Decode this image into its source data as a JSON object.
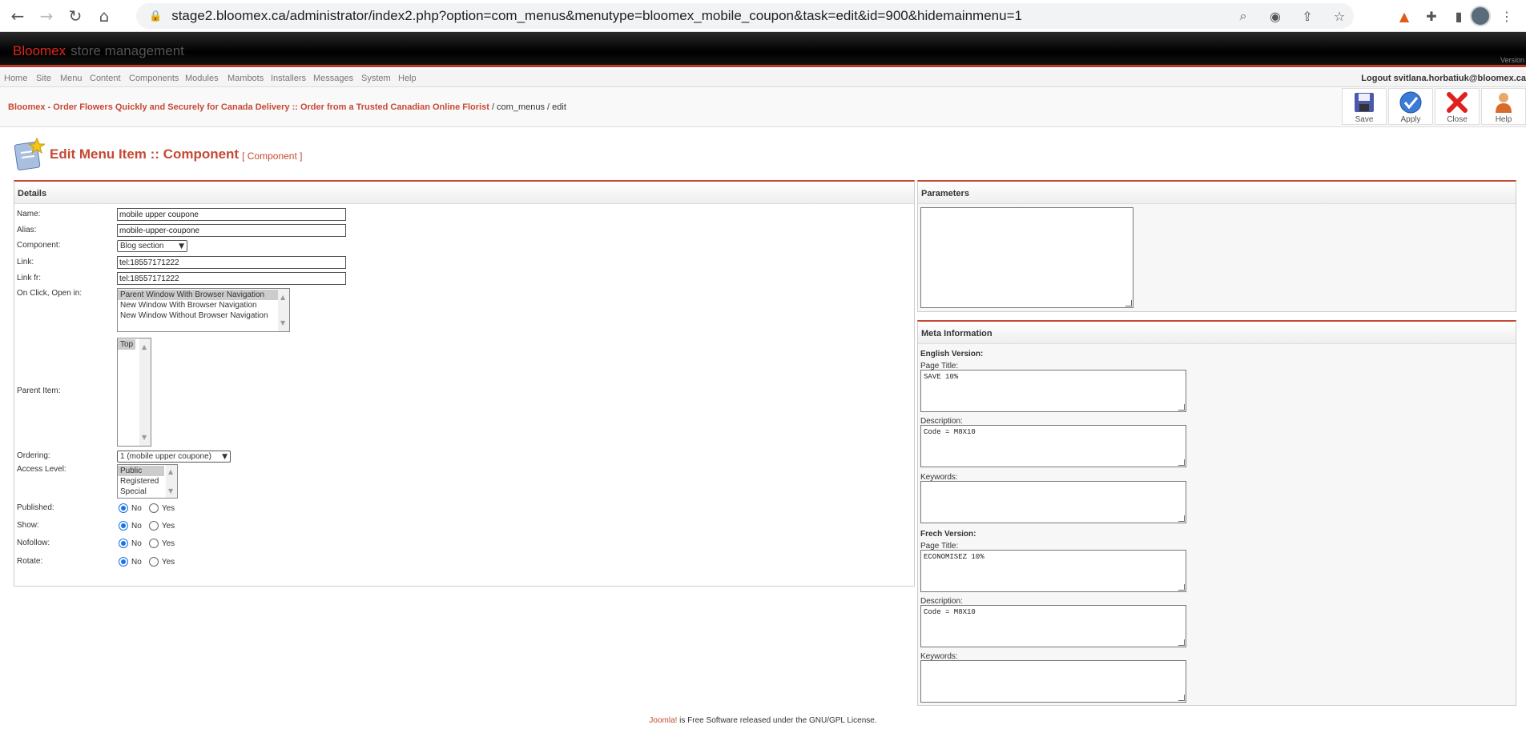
{
  "browser": {
    "url": "stage2.bloomex.ca/administrator/index2.php?option=com_menus&menutype=bloomex_mobile_coupon&task=edit&id=900&hidemainmenu=1"
  },
  "header": {
    "brand_main": "Bloomex",
    "brand_sub": "store management",
    "version": "Version"
  },
  "menu": {
    "items": [
      "Home",
      "Site",
      "Menu",
      "Content",
      "Components",
      "Modules",
      "Mambots",
      "Installers",
      "Messages",
      "System",
      "Help"
    ],
    "logout": "Logout svitlana.horbatiuk@bloomex.ca"
  },
  "pathway": {
    "site": "Bloomex - Order Flowers Quickly and Securely for Canada Delivery :: Order from a Trusted Canadian Online Florist",
    "rest": " / com_menus / edit"
  },
  "toolbar": {
    "save": "Save",
    "apply": "Apply",
    "close": "Close",
    "help": "Help"
  },
  "page": {
    "title": "Edit Menu Item :: Component",
    "subtitle": "[ Component ]"
  },
  "details": {
    "heading": "Details",
    "name_label": "Name:",
    "name_value": "mobile upper coupone",
    "alias_label": "Alias:",
    "alias_value": "mobile-upper-coupone",
    "component_label": "Component:",
    "component_value": "Blog section",
    "link_label": "Link:",
    "link_value": "tel:18557171222",
    "linkfr_label": "Link fr:",
    "linkfr_value": "tel:18557171222",
    "onclick_label": "On Click, Open in:",
    "onclick_options": [
      "Parent Window With Browser Navigation",
      "New Window With Browser Navigation",
      "New Window Without Browser Navigation"
    ],
    "parent_label": "Parent Item:",
    "parent_options": [
      "Top"
    ],
    "ordering_label": "Ordering:",
    "ordering_value": "1 (mobile upper coupone)",
    "access_label": "Access Level:",
    "access_options": [
      "Public",
      "Registered",
      "Special"
    ],
    "published_label": "Published:",
    "show_label": "Show:",
    "nofollow_label": "Nofollow:",
    "rotate_label": "Rotate:",
    "no": "No",
    "yes": "Yes"
  },
  "parameters": {
    "heading": "Parameters"
  },
  "meta": {
    "heading": "Meta Information",
    "english": "English Version:",
    "french": "Frech Version:",
    "page_title_label": "Page Title:",
    "description_label": "Description:",
    "keywords_label": "Keywords:",
    "en_page_title": "SAVE 10%",
    "en_description": "Code = M8X10",
    "en_keywords": "",
    "fr_page_title": "ECONOMISEZ 10%",
    "fr_description": "Code = M8X10",
    "fr_keywords": ""
  },
  "footer": {
    "joomla": "Joomla!",
    "text": " is Free Software released under the GNU/GPL License."
  }
}
